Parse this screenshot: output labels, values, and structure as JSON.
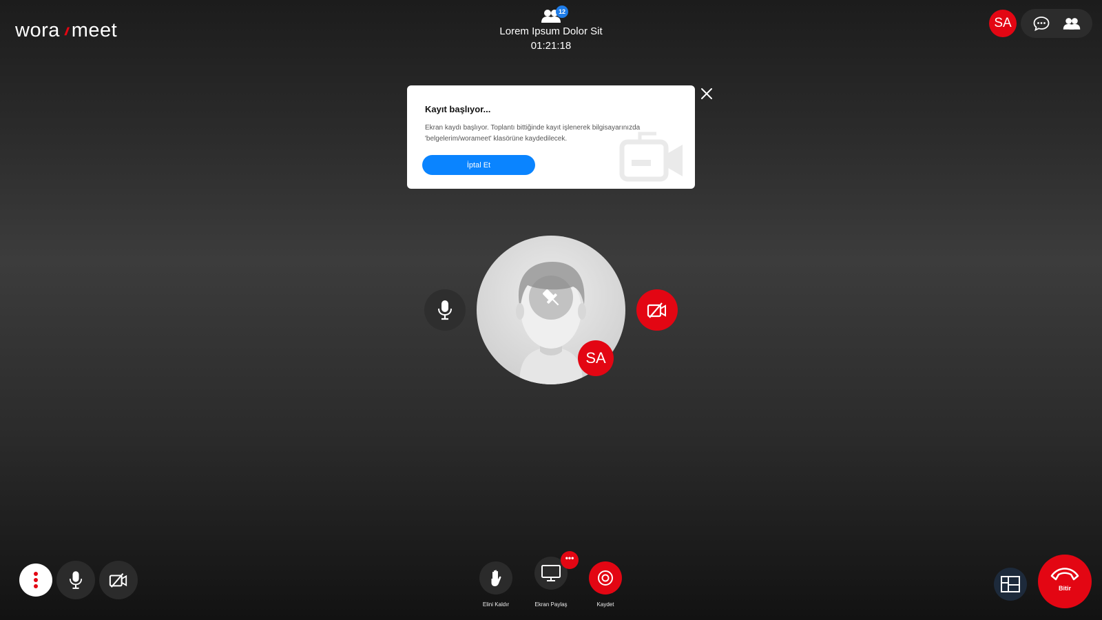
{
  "app": {
    "logo_left": "wora",
    "logo_slashes": "//",
    "logo_right": "meet"
  },
  "meeting": {
    "title": "Lorem Ipsum Dolor Sit",
    "time": "01:21:18",
    "participant_count": "12"
  },
  "user": {
    "initials": "SA"
  },
  "top_actions": {
    "icons": [
      "chat-icon",
      "participants-icon"
    ]
  },
  "modal": {
    "title": "Kayıt başlıyor...",
    "text": "Ekran kaydı başlıyor. Toplantı bittiğinde kayıt işlenerek bilgisayarınızda 'belgelerim/worameet' klasörüne kaydedilecek.",
    "cancel_label": "İptal Et"
  },
  "toolbar": {
    "raise_hand_label": "Elini Kaldır",
    "share_screen_label": "Ekran Paylaş",
    "share_badge": "•••",
    "record_label": "Kaydet",
    "end_label": "Bitir"
  },
  "colors": {
    "accent_red": "#e30613",
    "primary_blue": "#0a84ff",
    "badge_blue": "#1e7ce8",
    "layout_btn": "#1d2a3b"
  }
}
